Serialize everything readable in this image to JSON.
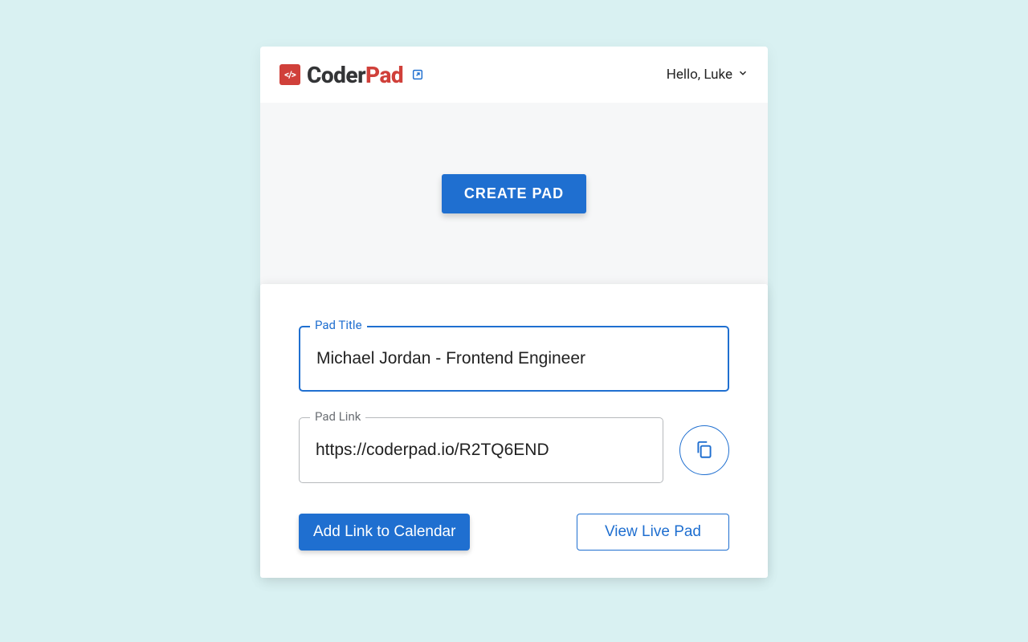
{
  "brand": {
    "name_part1": "Coder",
    "name_part2": "Pad",
    "badge_text": "</>"
  },
  "user_menu": {
    "greeting": "Hello, Luke"
  },
  "create": {
    "button_label": "CREATE PAD"
  },
  "form": {
    "title_field": {
      "label": "Pad Title",
      "value": "Michael Jordan - Frontend Engineer"
    },
    "link_field": {
      "label": "Pad Link",
      "value": "https://coderpad.io/R2TQ6END"
    },
    "actions": {
      "add_calendar": "Add Link to Calendar",
      "view_live": "View Live Pad"
    }
  },
  "colors": {
    "primary": "#1f6fd0",
    "accent": "#d0403a",
    "page_bg": "#d9f1f2"
  }
}
